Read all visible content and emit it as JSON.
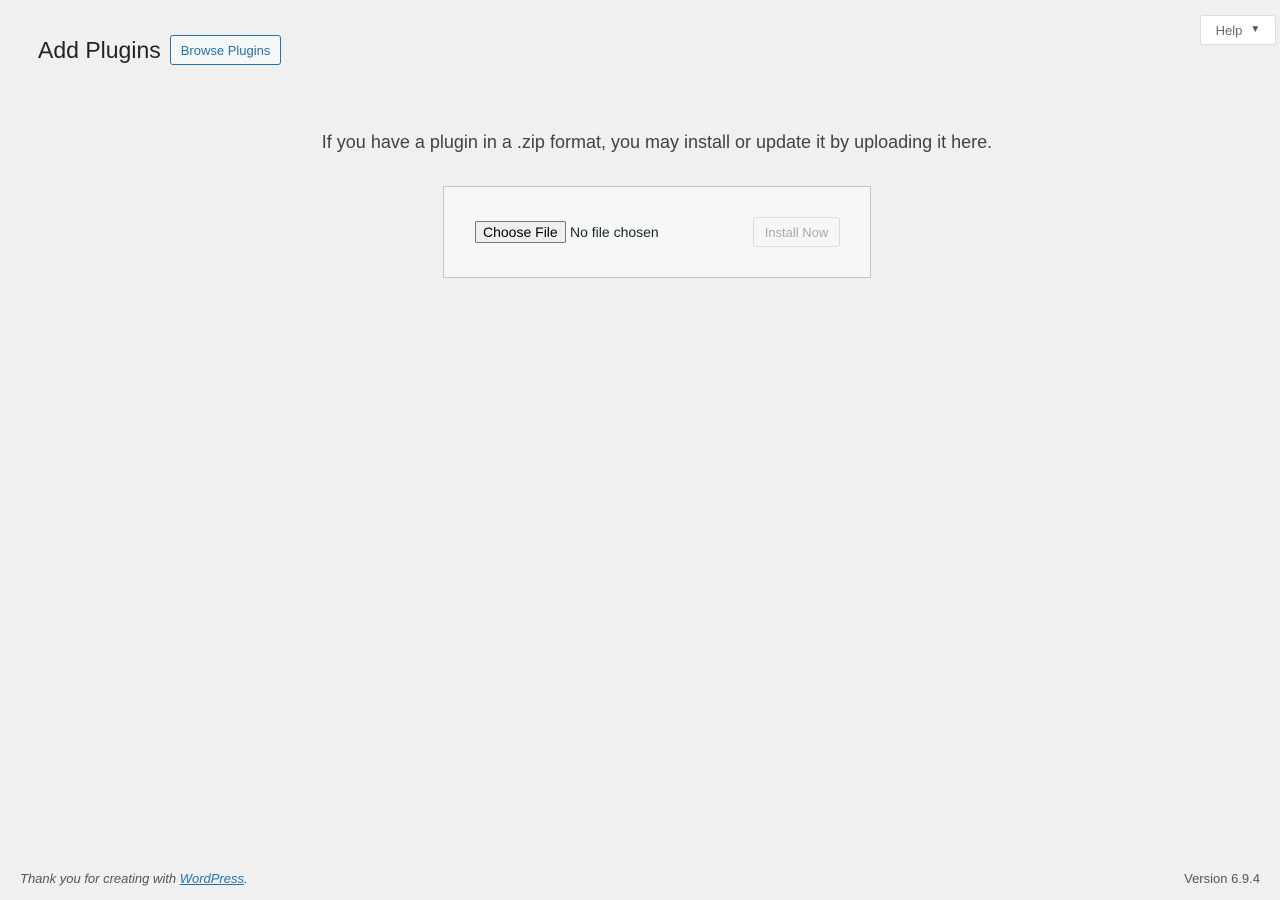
{
  "help_tab": {
    "label": "Help",
    "caret": "▼"
  },
  "header": {
    "title": "Add Plugins",
    "browse_label": "Browse Plugins"
  },
  "upload": {
    "instructions": "If you have a plugin in a .zip format, you may install or update it by uploading it here.",
    "choose_file_label": "Choose File",
    "file_status": "No file chosen",
    "install_label": "Install Now"
  },
  "footer": {
    "thanks_prefix": "Thank you for creating with ",
    "link_text": "WordPress",
    "thanks_suffix": ".",
    "version": "Version 6.9.4"
  },
  "colors": {
    "background": "#f0f0f1",
    "accent": "#2271b1",
    "text": "#3c434a",
    "disabled_text": "#a7aaad"
  }
}
